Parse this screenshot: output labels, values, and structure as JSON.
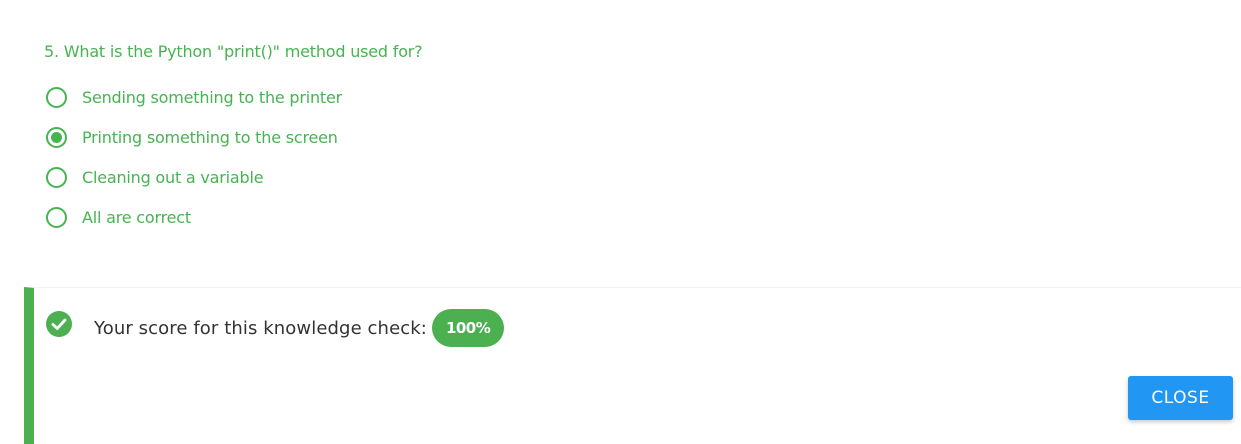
{
  "quiz": {
    "question": "5. What is the Python \"print()\" method used for?",
    "options": [
      {
        "label": "Sending something to the printer",
        "selected": false
      },
      {
        "label": "Printing something to the screen",
        "selected": true
      },
      {
        "label": "Cleaning out a variable",
        "selected": false
      },
      {
        "label": "All are correct",
        "selected": false
      }
    ]
  },
  "result": {
    "icon": "check-circle-icon",
    "score_label": "Your score for this knowledge check:",
    "score_value": "100%"
  },
  "actions": {
    "close_label": "CLOSE"
  },
  "colors": {
    "option_green": "#46b450",
    "success_green": "#4caf50",
    "button_blue": "#2196f3"
  }
}
